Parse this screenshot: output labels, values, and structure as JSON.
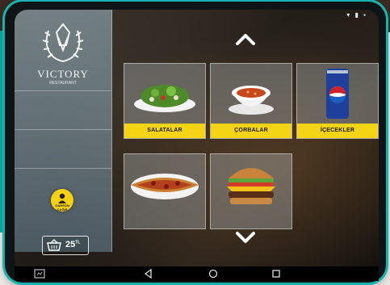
{
  "brand": {
    "name": "VICTORY",
    "subtitle": "RESTAURANT"
  },
  "status_bar": {
    "icons": [
      "signal-icon",
      "wifi-icon",
      "battery-icon"
    ],
    "indicators": "▾ ▮ ▪"
  },
  "waiter_button": {
    "label": "GARSON ÇAĞIR"
  },
  "cart": {
    "price": "25",
    "currency": "TL"
  },
  "categories": [
    {
      "label": "SALATALAR"
    },
    {
      "label": "ÇORBALAR"
    },
    {
      "label": "İÇECEKLER"
    },
    {
      "label": ""
    },
    {
      "label": ""
    }
  ],
  "android_nav": [
    "screenshot-icon",
    "back-icon",
    "home-icon",
    "recents-icon"
  ],
  "colors": {
    "accent": "#f4d414",
    "frame": "#18b3b0",
    "sidebar": "#9fbccb"
  }
}
